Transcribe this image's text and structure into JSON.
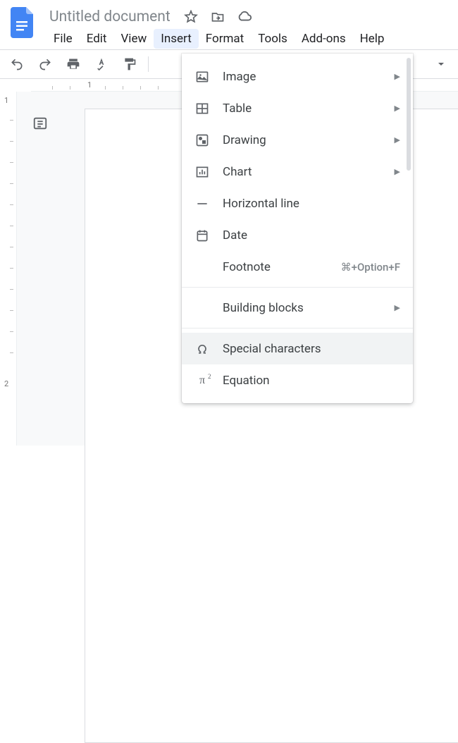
{
  "header": {
    "title": "Untitled document"
  },
  "menubar": {
    "items": [
      {
        "label": "File"
      },
      {
        "label": "Edit"
      },
      {
        "label": "View"
      },
      {
        "label": "Insert"
      },
      {
        "label": "Format"
      },
      {
        "label": "Tools"
      },
      {
        "label": "Add-ons"
      },
      {
        "label": "Help"
      }
    ]
  },
  "ruler": {
    "h1": "1",
    "v1": "1",
    "v2": "2"
  },
  "insert_menu": {
    "items": [
      {
        "label": "Image",
        "icon": "image-icon",
        "submenu": true
      },
      {
        "label": "Table",
        "icon": "table-icon",
        "submenu": true
      },
      {
        "label": "Drawing",
        "icon": "drawing-icon",
        "submenu": true
      },
      {
        "label": "Chart",
        "icon": "chart-icon",
        "submenu": true
      },
      {
        "label": "Horizontal line",
        "icon": "horizontal-line-icon"
      },
      {
        "label": "Date",
        "icon": "date-icon"
      },
      {
        "label": "Footnote",
        "icon": "",
        "shortcut": "⌘+Option+F"
      }
    ],
    "items2": [
      {
        "label": "Building blocks",
        "icon": "",
        "submenu": true
      }
    ],
    "items3": [
      {
        "label": "Special characters",
        "icon": "omega-icon",
        "hover": true
      },
      {
        "label": "Equation",
        "icon": "pi-icon"
      }
    ]
  }
}
